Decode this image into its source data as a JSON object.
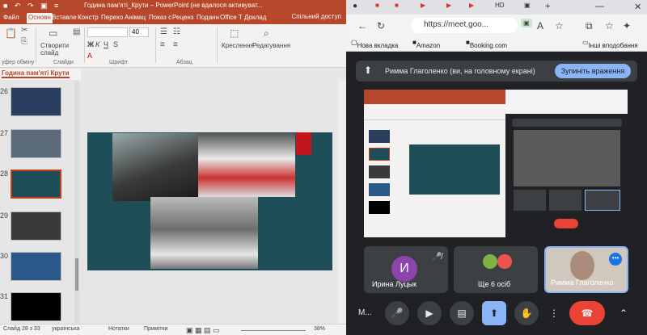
{
  "ppt": {
    "qa_icons": "■ ↶ ↷ ▣ ≡",
    "doc_title": "Година пам'яті_Крути – PowerPoint (не вдалося активуват...",
    "tabs": [
      "Файл",
      "Основн",
      "Вставле",
      "Констр",
      "Перехо",
      "Анімац",
      "Показ с",
      "Реценз",
      "Поданн",
      "Office T",
      "Доклад"
    ],
    "share": "Спільний доступ",
    "ribbon": {
      "clipboard_group": "уфер обміну",
      "slides_label": "Створити слайд",
      "slides_group": "Слайди",
      "font_size": "40",
      "font_group": "Шрифт",
      "paragraph_group": "Абзац",
      "drawing_label": "Креслення",
      "editing_label": "Редагування"
    },
    "section_tab": "Година пам'яті Крути",
    "thumbnails": [
      {
        "num": "26",
        "color": "#2a3f5f"
      },
      {
        "num": "27",
        "color": "#5b6b7a"
      },
      {
        "num": "28",
        "color": "#1e4e57"
      },
      {
        "num": "29",
        "color": "#3a3a3a"
      },
      {
        "num": "30",
        "color": "#2b5a8a"
      },
      {
        "num": "31",
        "color": "#000000"
      }
    ],
    "status": {
      "slide": "Слайд 28 з 33",
      "lang": "українська",
      "notes": "Нотатки",
      "comments": "Примітки",
      "zoom": "38%"
    }
  },
  "browser": {
    "tabs": [
      "HD"
    ],
    "url": "https://meet.goo...",
    "bookmarks": [
      "Нова вкладка",
      "Amazon",
      "Booking.com",
      "Інші вподобання"
    ]
  },
  "meet": {
    "presenting_text": "Римма Глаголенко (ви, на головному екрані)",
    "stop_button": "Зупиніть враження",
    "participants": [
      {
        "name": "Ирина Луцык",
        "initial": "И",
        "color": "#8e44ad"
      },
      {
        "name": "Ще 6 осіб"
      },
      {
        "name": "Римма Глаголенко"
      }
    ],
    "meeting_code_short": "M...",
    "more_label": "•••"
  }
}
